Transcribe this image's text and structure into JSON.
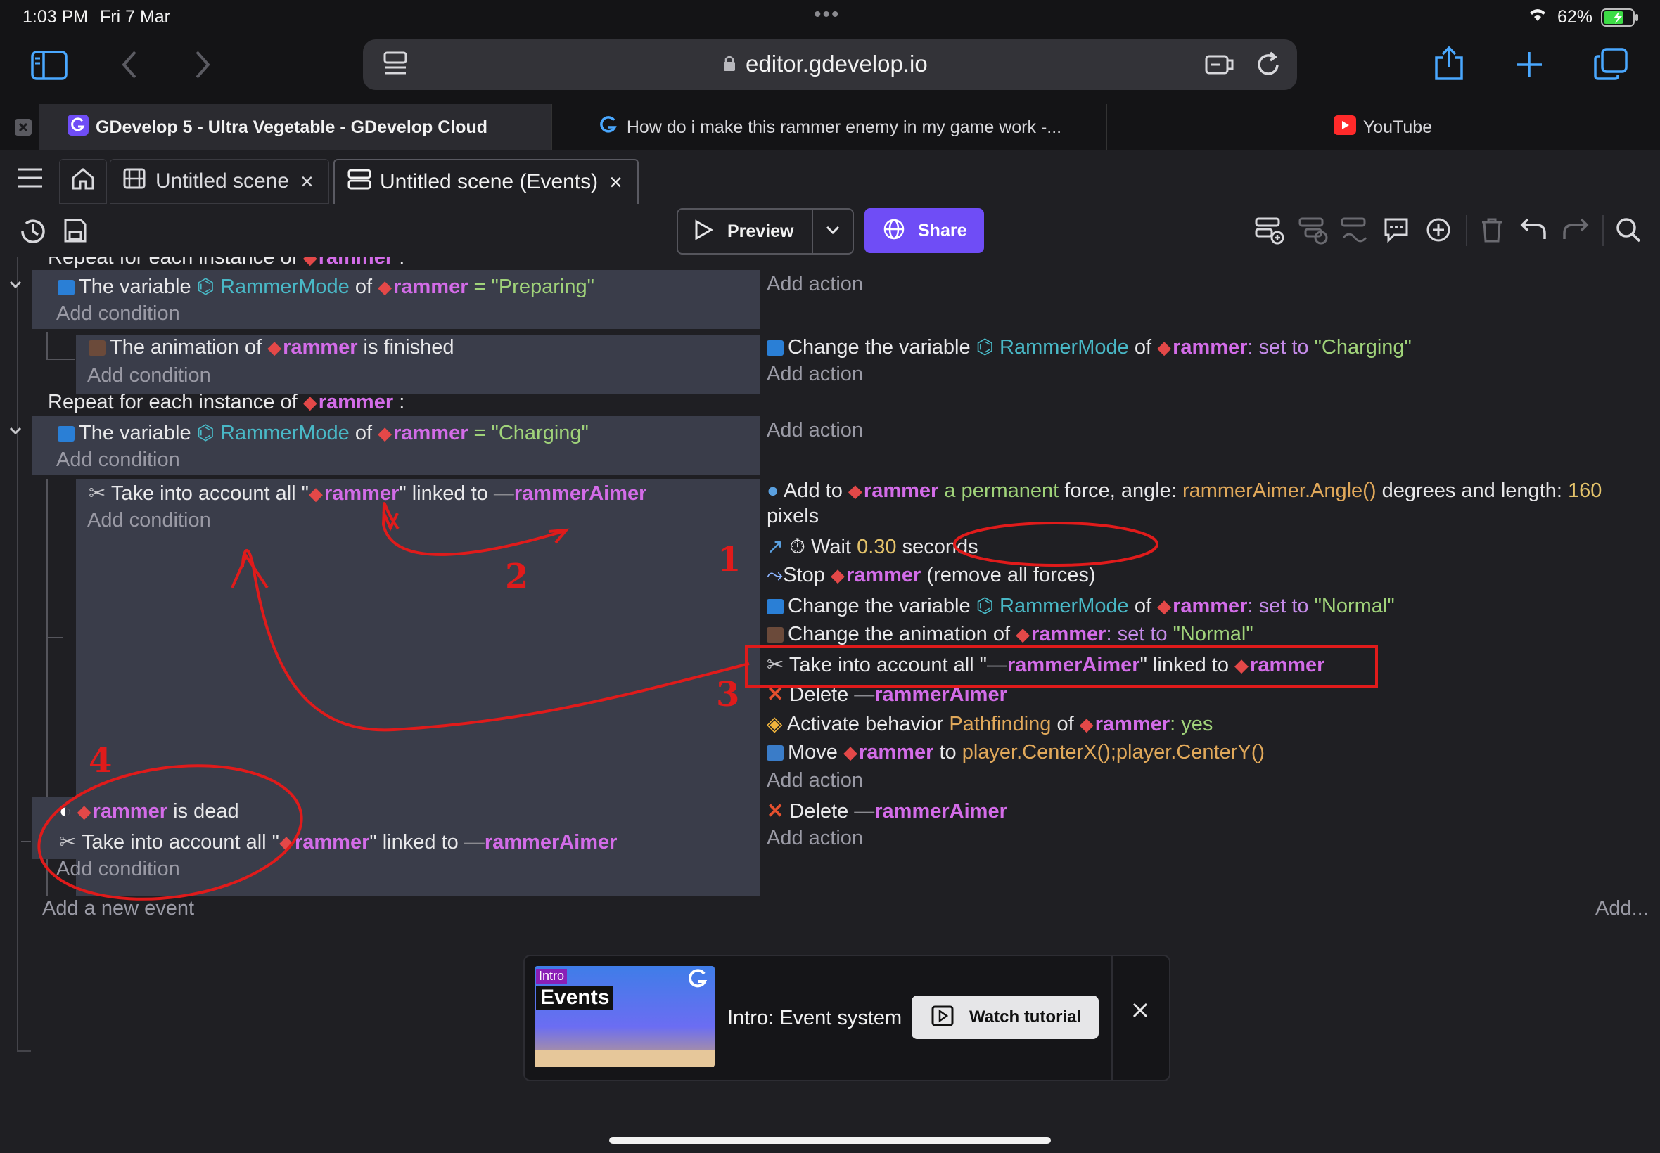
{
  "status_bar": {
    "time": "1:03 PM",
    "date": "Fri 7 Mar",
    "battery": "62%"
  },
  "browser": {
    "url": "editor.gdevelop.io",
    "tabs": [
      {
        "label": "GDevelop 5 - Ultra Vegetable - GDevelop Cloud"
      },
      {
        "label": "How do i make this rammer enemy in my game work -..."
      },
      {
        "label": "YouTube"
      }
    ]
  },
  "editor_tabs": [
    {
      "label": "Untitled scene"
    },
    {
      "label": "Untitled scene (Events)"
    }
  ],
  "toolbar": {
    "preview_label": "Preview",
    "share_label": "Share"
  },
  "events": {
    "repeat_header_partial": "Repeat for each instance of",
    "repeat_header_1_obj": "rammer",
    "e1_cond_prefix": "The variable",
    "e1_cond_var": "RammerMode",
    "e1_cond_of": "of",
    "e1_cond_obj": "rammer",
    "e1_cond_eq": "=",
    "e1_cond_val": "\"Preparing\"",
    "add_condition": "Add condition",
    "add_action": "Add action",
    "sub1_cond_prefix": "The animation of",
    "sub1_cond_obj": "rammer",
    "sub1_cond_suffix": "is finished",
    "sub1_act_prefix": "Change the variable",
    "sub1_act_var": "RammerMode",
    "sub1_act_of": "of",
    "sub1_act_obj": "rammer",
    "sub1_act_setto": ": set to",
    "sub1_act_val": "\"Charging\"",
    "repeat2_prefix": "Repeat for each instance of",
    "repeat2_obj": "rammer",
    "repeat2_colon": ":",
    "e2_cond_val": "\"Charging\"",
    "sub2_cond_prefix": "Take into account all \"",
    "sub2_cond_obj": "rammer",
    "sub2_cond_mid": "\" linked to",
    "sub2_cond_obj2": "rammerAimer",
    "a1_prefix": "Add to",
    "a1_obj": "rammer",
    "a1_mid": "a permanent",
    "a1_mid2": "force, angle:",
    "a1_expr": "rammerAimer.Angle()",
    "a1_mid3": "degrees and length:",
    "a1_num": "160",
    "a1_unit": "pixels",
    "a2_prefix": "Wait",
    "a2_num": "0.30",
    "a2_suffix": "seconds",
    "a3_prefix": "Stop",
    "a3_obj": "rammer",
    "a3_suffix": "(remove all forces)",
    "a4_val": "\"Normal\"",
    "a5_prefix": "Change the animation of",
    "a5_setto": ": set to",
    "a5_val": "\"Normal\"",
    "a6_prefix": "Take into account all \"",
    "a6_obj": "rammerAimer",
    "a6_mid": "\" linked to",
    "a6_obj2": "rammer",
    "a7_prefix": "Delete",
    "a7_obj": "rammerAimer",
    "a8_prefix": "Activate behavior",
    "a8_beh": "Pathfinding",
    "a8_of": "of",
    "a8_obj": "rammer",
    "a8_val": ": yes",
    "a9_prefix": "Move",
    "a9_obj": "rammer",
    "a9_to": "to",
    "a9_expr": "player.CenterX();player.CenterY()",
    "sub3_cond1_obj": "rammer",
    "sub3_cond1_suffix": "is dead",
    "add_new_event": "Add a new event",
    "add_more": "Add..."
  },
  "annotations": [
    "1",
    "2",
    "3",
    "4"
  ],
  "tutorial": {
    "thumb_badge": "Intro",
    "thumb_title": "Events",
    "title": "Intro: Event system",
    "button": "Watch tutorial"
  },
  "colors": {
    "accent": "#6f4df6",
    "object": "#d36ce8",
    "variable": "#49b8c6",
    "string": "#a0d37a",
    "number": "#e3c26a",
    "annotation": "#e01b1b",
    "safari_blue": "#4aa8ff"
  }
}
